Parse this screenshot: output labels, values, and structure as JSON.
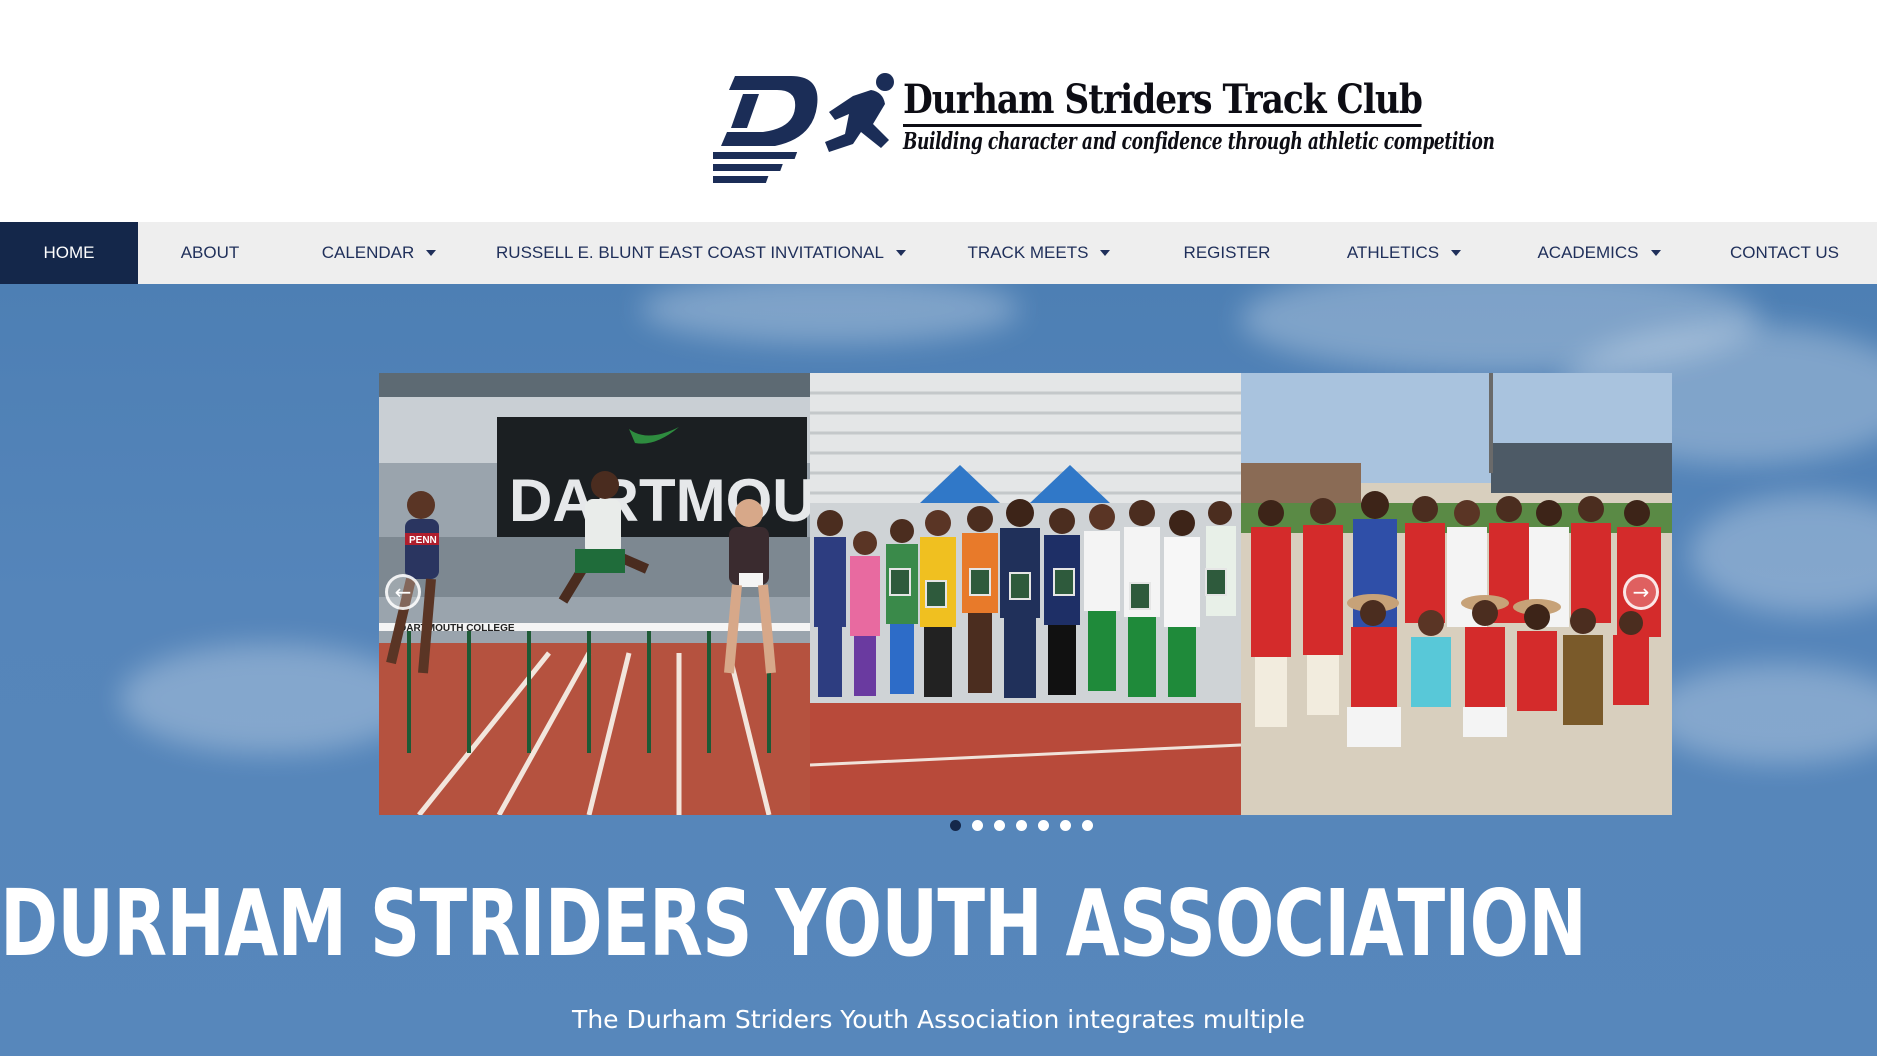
{
  "brand": {
    "title": "Durham Striders Track Club",
    "tagline": "Building character and confidence through athletic competition",
    "colors": {
      "navy": "#14274a",
      "nav_text": "#1f2f5a",
      "nav_bg": "#eeeeee",
      "hero_bg": "#5585ba"
    }
  },
  "nav": {
    "items": [
      {
        "label": "HOME",
        "active": true,
        "dropdown": false
      },
      {
        "label": "ABOUT",
        "active": false,
        "dropdown": false
      },
      {
        "label": "CALENDAR",
        "active": false,
        "dropdown": true
      },
      {
        "label": "RUSSELL E. BLUNT EAST COAST INVITATIONAL",
        "active": false,
        "dropdown": true
      },
      {
        "label": "TRACK MEETS",
        "active": false,
        "dropdown": true
      },
      {
        "label": "REGISTER",
        "active": false,
        "dropdown": false
      },
      {
        "label": "ATHLETICS",
        "active": false,
        "dropdown": true
      },
      {
        "label": "ACADEMICS",
        "active": false,
        "dropdown": true
      },
      {
        "label": "CONTACT US",
        "active": false,
        "dropdown": false
      }
    ]
  },
  "slider": {
    "prev_icon": "arrow-left-circle-icon",
    "next_icon": "arrow-right-circle-icon",
    "dot_count": 7,
    "active_dot": 0,
    "slides": [
      {
        "photo": "hurdles-race",
        "banner_text": "DARTMOUTH",
        "hurdle_text": "DARTMOUTH COLLEGE",
        "bib_text": "PENN"
      },
      {
        "photo": "award-winners-group"
      },
      {
        "photo": "team-staff-group"
      }
    ]
  },
  "hero": {
    "title": "DURHAM STRIDERS YOUTH ASSOCIATION",
    "text": "The Durham Striders Youth Association integrates multiple"
  }
}
